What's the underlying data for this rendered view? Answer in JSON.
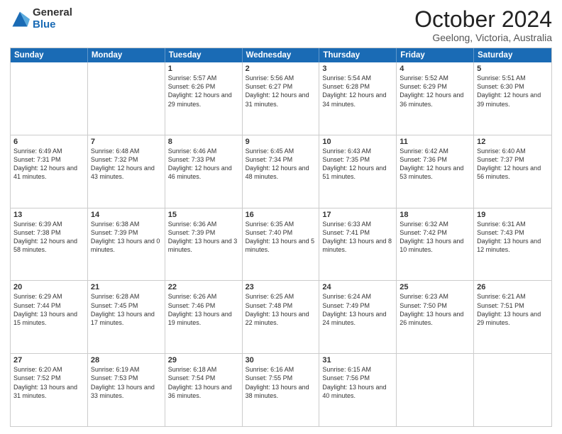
{
  "logo": {
    "general": "General",
    "blue": "Blue"
  },
  "header": {
    "month": "October 2024",
    "location": "Geelong, Victoria, Australia"
  },
  "days": [
    "Sunday",
    "Monday",
    "Tuesday",
    "Wednesday",
    "Thursday",
    "Friday",
    "Saturday"
  ],
  "weeks": [
    [
      {
        "day": "",
        "text": ""
      },
      {
        "day": "",
        "text": ""
      },
      {
        "day": "1",
        "text": "Sunrise: 5:57 AM\nSunset: 6:26 PM\nDaylight: 12 hours and 29 minutes."
      },
      {
        "day": "2",
        "text": "Sunrise: 5:56 AM\nSunset: 6:27 PM\nDaylight: 12 hours and 31 minutes."
      },
      {
        "day": "3",
        "text": "Sunrise: 5:54 AM\nSunset: 6:28 PM\nDaylight: 12 hours and 34 minutes."
      },
      {
        "day": "4",
        "text": "Sunrise: 5:52 AM\nSunset: 6:29 PM\nDaylight: 12 hours and 36 minutes."
      },
      {
        "day": "5",
        "text": "Sunrise: 5:51 AM\nSunset: 6:30 PM\nDaylight: 12 hours and 39 minutes."
      }
    ],
    [
      {
        "day": "6",
        "text": "Sunrise: 6:49 AM\nSunset: 7:31 PM\nDaylight: 12 hours and 41 minutes."
      },
      {
        "day": "7",
        "text": "Sunrise: 6:48 AM\nSunset: 7:32 PM\nDaylight: 12 hours and 43 minutes."
      },
      {
        "day": "8",
        "text": "Sunrise: 6:46 AM\nSunset: 7:33 PM\nDaylight: 12 hours and 46 minutes."
      },
      {
        "day": "9",
        "text": "Sunrise: 6:45 AM\nSunset: 7:34 PM\nDaylight: 12 hours and 48 minutes."
      },
      {
        "day": "10",
        "text": "Sunrise: 6:43 AM\nSunset: 7:35 PM\nDaylight: 12 hours and 51 minutes."
      },
      {
        "day": "11",
        "text": "Sunrise: 6:42 AM\nSunset: 7:36 PM\nDaylight: 12 hours and 53 minutes."
      },
      {
        "day": "12",
        "text": "Sunrise: 6:40 AM\nSunset: 7:37 PM\nDaylight: 12 hours and 56 minutes."
      }
    ],
    [
      {
        "day": "13",
        "text": "Sunrise: 6:39 AM\nSunset: 7:38 PM\nDaylight: 12 hours and 58 minutes."
      },
      {
        "day": "14",
        "text": "Sunrise: 6:38 AM\nSunset: 7:39 PM\nDaylight: 13 hours and 0 minutes."
      },
      {
        "day": "15",
        "text": "Sunrise: 6:36 AM\nSunset: 7:39 PM\nDaylight: 13 hours and 3 minutes."
      },
      {
        "day": "16",
        "text": "Sunrise: 6:35 AM\nSunset: 7:40 PM\nDaylight: 13 hours and 5 minutes."
      },
      {
        "day": "17",
        "text": "Sunrise: 6:33 AM\nSunset: 7:41 PM\nDaylight: 13 hours and 8 minutes."
      },
      {
        "day": "18",
        "text": "Sunrise: 6:32 AM\nSunset: 7:42 PM\nDaylight: 13 hours and 10 minutes."
      },
      {
        "day": "19",
        "text": "Sunrise: 6:31 AM\nSunset: 7:43 PM\nDaylight: 13 hours and 12 minutes."
      }
    ],
    [
      {
        "day": "20",
        "text": "Sunrise: 6:29 AM\nSunset: 7:44 PM\nDaylight: 13 hours and 15 minutes."
      },
      {
        "day": "21",
        "text": "Sunrise: 6:28 AM\nSunset: 7:45 PM\nDaylight: 13 hours and 17 minutes."
      },
      {
        "day": "22",
        "text": "Sunrise: 6:26 AM\nSunset: 7:46 PM\nDaylight: 13 hours and 19 minutes."
      },
      {
        "day": "23",
        "text": "Sunrise: 6:25 AM\nSunset: 7:48 PM\nDaylight: 13 hours and 22 minutes."
      },
      {
        "day": "24",
        "text": "Sunrise: 6:24 AM\nSunset: 7:49 PM\nDaylight: 13 hours and 24 minutes."
      },
      {
        "day": "25",
        "text": "Sunrise: 6:23 AM\nSunset: 7:50 PM\nDaylight: 13 hours and 26 minutes."
      },
      {
        "day": "26",
        "text": "Sunrise: 6:21 AM\nSunset: 7:51 PM\nDaylight: 13 hours and 29 minutes."
      }
    ],
    [
      {
        "day": "27",
        "text": "Sunrise: 6:20 AM\nSunset: 7:52 PM\nDaylight: 13 hours and 31 minutes."
      },
      {
        "day": "28",
        "text": "Sunrise: 6:19 AM\nSunset: 7:53 PM\nDaylight: 13 hours and 33 minutes."
      },
      {
        "day": "29",
        "text": "Sunrise: 6:18 AM\nSunset: 7:54 PM\nDaylight: 13 hours and 36 minutes."
      },
      {
        "day": "30",
        "text": "Sunrise: 6:16 AM\nSunset: 7:55 PM\nDaylight: 13 hours and 38 minutes."
      },
      {
        "day": "31",
        "text": "Sunrise: 6:15 AM\nSunset: 7:56 PM\nDaylight: 13 hours and 40 minutes."
      },
      {
        "day": "",
        "text": ""
      },
      {
        "day": "",
        "text": ""
      }
    ]
  ]
}
